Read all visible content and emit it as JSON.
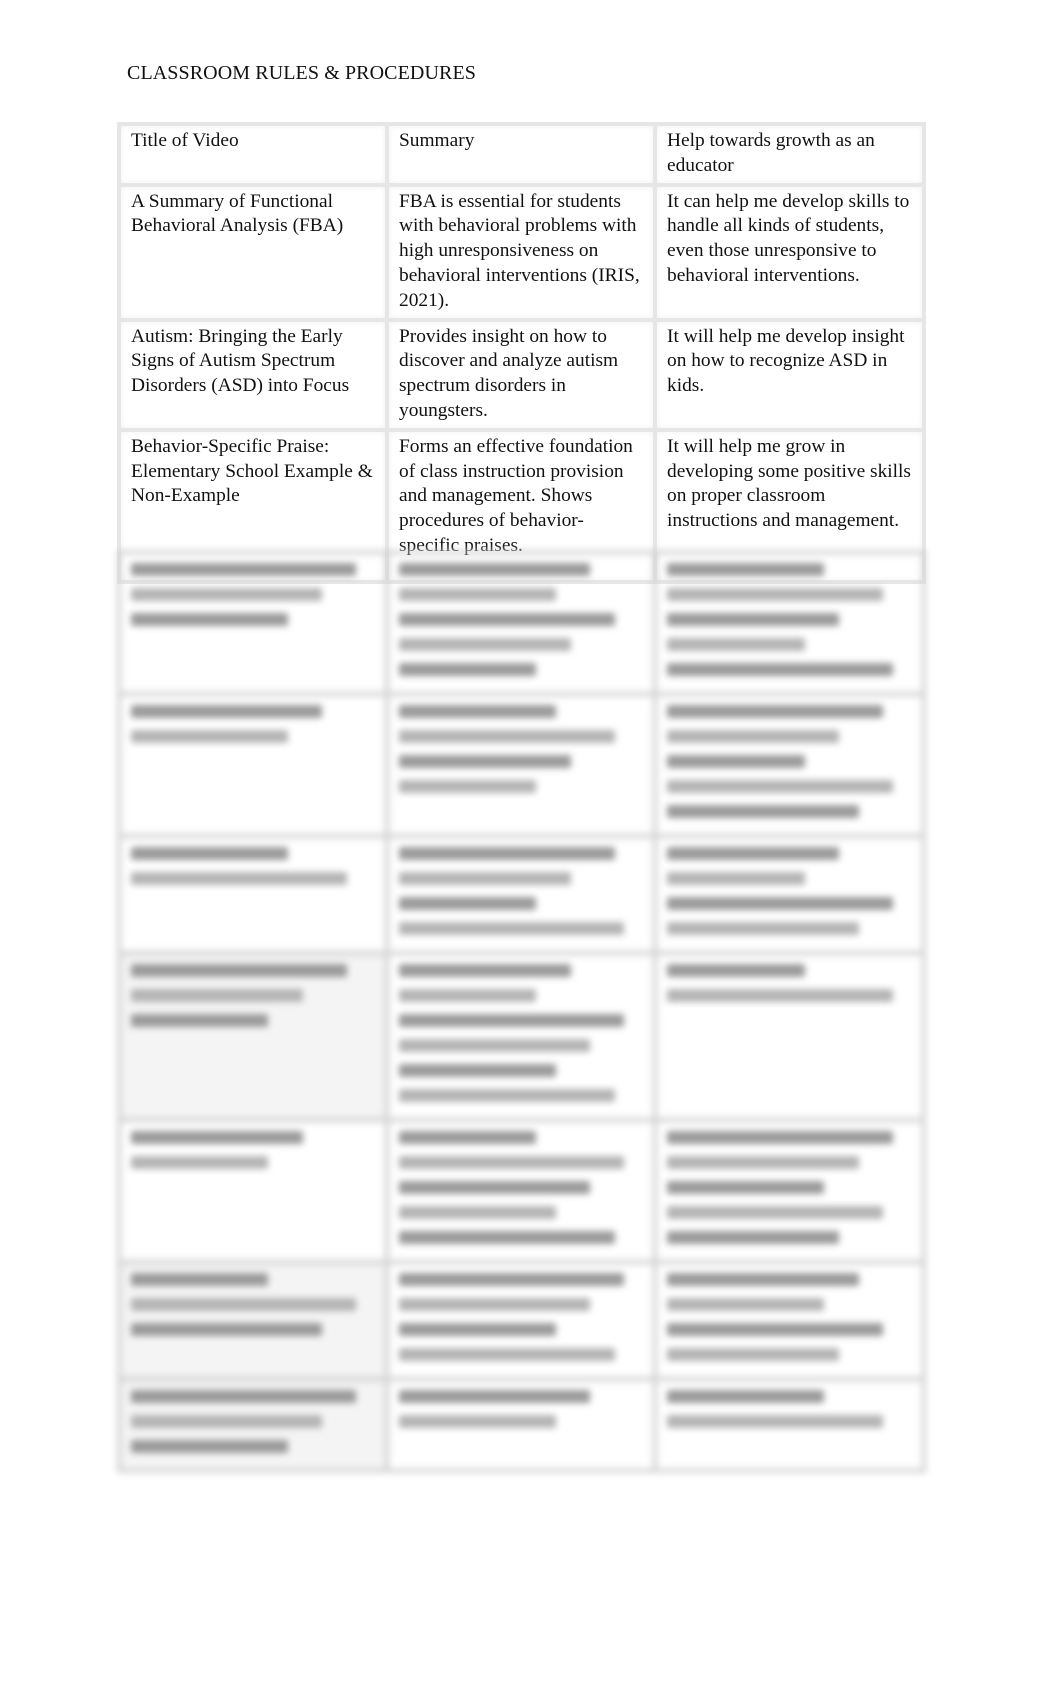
{
  "document": {
    "title": "CLASSROOM RULES & PROCEDURES"
  },
  "table": {
    "headers": [
      "Title of Video",
      "Summary",
      "Help towards growth as an educator"
    ],
    "rows": [
      {
        "title": "A Summary of Functional Behavioral Analysis (FBA)",
        "summary": "FBA is essential for students with behavioral problems with high unresponsiveness on behavioral interventions (IRIS, 2021).",
        "growth": "It can help me develop skills to handle all kinds of students, even those unresponsive to behavioral interventions."
      },
      {
        "title": "Autism: Bringing the Early Signs of Autism Spectrum Disorders (ASD) into Focus",
        "summary": "Provides insight on how to discover and analyze autism spectrum disorders in youngsters.",
        "growth": "It will help me develop insight on how to recognize ASD in kids."
      },
      {
        "title": "Behavior-Specific Praise: Elementary School Example & Non-Example",
        "summary": "Forms an effective foundation of class instruction provision and management. Shows procedures of behavior-specific praises.",
        "growth": "It will help me grow in developing some positive skills on proper classroom instructions and management."
      }
    ],
    "blurred_row_count": 8
  }
}
